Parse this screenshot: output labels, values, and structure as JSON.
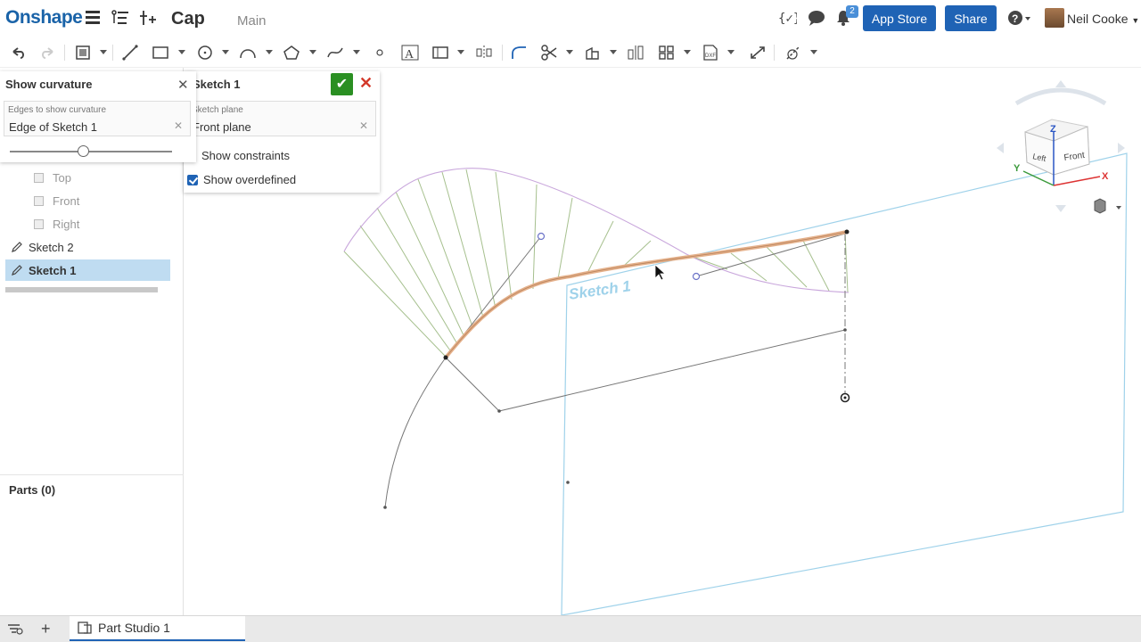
{
  "header": {
    "logo": "Onshape",
    "doc_title": "Cap",
    "branch": "Main",
    "notification_count": "2",
    "app_store_label": "App Store",
    "share_label": "Share",
    "help_symbol": "?",
    "user_name": "Neil Cooke"
  },
  "curvature_dialog": {
    "title": "Show curvature",
    "field_label": "Edges to show curvature",
    "field_value": "Edge of Sketch 1",
    "slider_position": 0.45
  },
  "sketch_dialog": {
    "title": "Sketch 1",
    "plane_label": "Sketch plane",
    "plane_value": "Front plane",
    "show_constraints_label": "Show constraints",
    "show_constraints_checked": false,
    "show_overdefined_label": "Show overdefined",
    "show_overdefined_checked": true
  },
  "feature_tree": {
    "planes": [
      "Top",
      "Front",
      "Right"
    ],
    "sketches": [
      "Sketch 2",
      "Sketch 1"
    ],
    "selected": "Sketch 1",
    "parts_label": "Parts (0)"
  },
  "canvas": {
    "sketch_label": "Sketch 1"
  },
  "viewcube": {
    "z_label": "Z",
    "x_label": "X",
    "y_label": "Y",
    "left_face": "Left",
    "front_face": "Front"
  },
  "bottom": {
    "tab_label": "Part Studio 1"
  },
  "colors": {
    "brand": "#1a63a8",
    "button": "#1f63b5",
    "curve": "#e4b08a",
    "comb": "#a6c08e",
    "envelope": "#c9a7dc",
    "plane": "#9fd2ea",
    "selection": "#bfdcf1"
  }
}
